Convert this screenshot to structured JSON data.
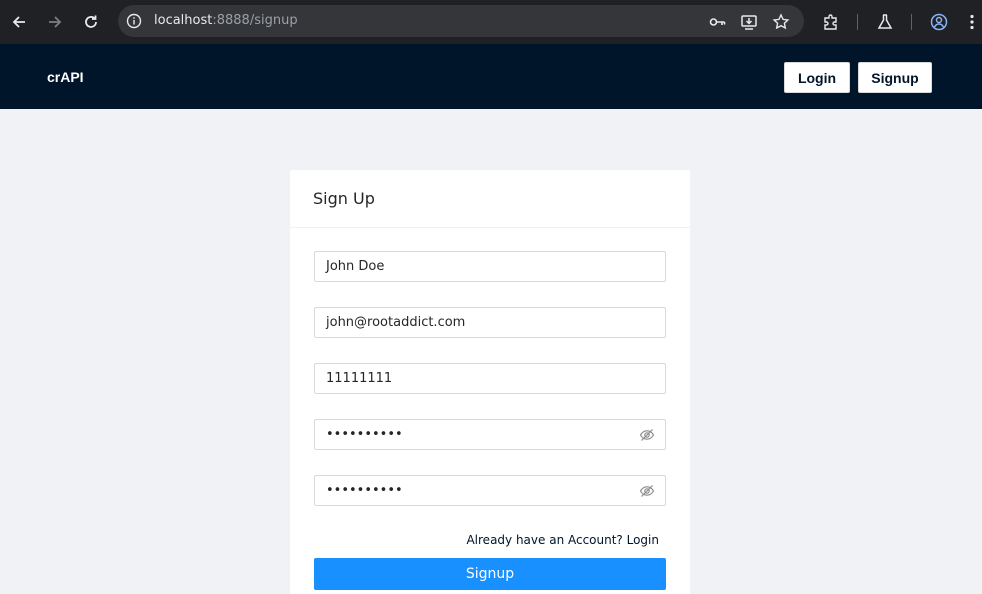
{
  "browser": {
    "url_host": "localhost",
    "url_rest": ":8888/signup",
    "icons": [
      "back-arrow-icon",
      "forward-arrow-icon",
      "reload-icon",
      "site-info-icon",
      "key-icon",
      "install-app-icon",
      "bookmark-star-icon",
      "extensions-icon",
      "labs-flask-icon",
      "profile-icon",
      "menu-kebab-icon"
    ]
  },
  "navbar": {
    "brand": "crAPI",
    "login_label": "Login",
    "signup_label": "Signup"
  },
  "form": {
    "title": "Sign Up",
    "name_value": "John Doe",
    "email_value": "john@rootaddict.com",
    "phone_value": "11111111",
    "password_value": "••••••••••",
    "confirm_password_value": "••••••••••",
    "login_link": "Already have an Account? Login",
    "submit_label": "Signup"
  },
  "colors": {
    "navbar": "#001529",
    "primary": "#1890ff",
    "page_bg": "#f0f2f5"
  }
}
